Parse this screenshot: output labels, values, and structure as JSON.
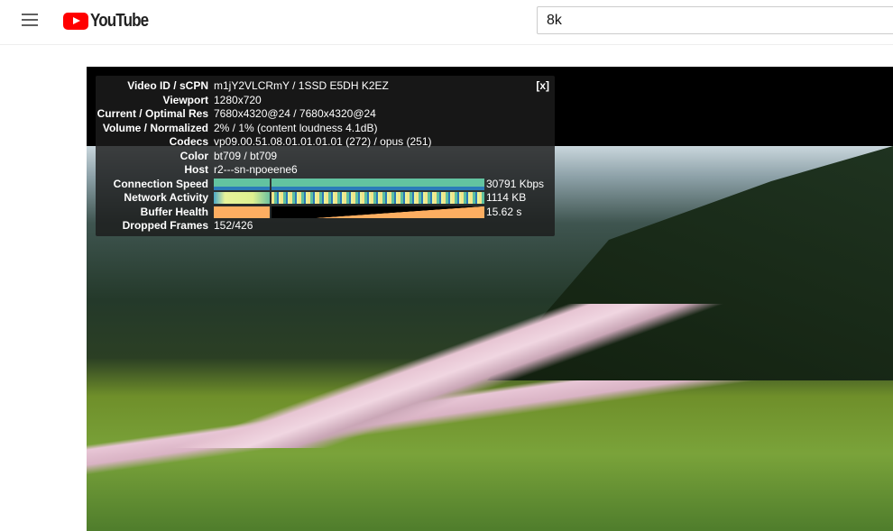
{
  "header": {
    "logo_text": "YouTube",
    "search_value": "8k"
  },
  "stats": {
    "close_label": "[x]",
    "rows": [
      {
        "label": "Video ID / sCPN",
        "value": "m1jY2VLCRmY / 1SSD E5DH K2EZ"
      },
      {
        "label": "Viewport",
        "value": "1280x720"
      },
      {
        "label": "Current / Optimal Res",
        "value": "7680x4320@24 / 7680x4320@24"
      },
      {
        "label": "Volume / Normalized",
        "value": "2% / 1% (content loudness 4.1dB)"
      },
      {
        "label": "Codecs",
        "value": "vp09.00.51.08.01.01.01.01 (272) / opus (251)"
      },
      {
        "label": "Color",
        "value": "bt709 / bt709"
      },
      {
        "label": "Host",
        "value": "r2---sn-npoeene6"
      },
      {
        "label": "Connection Speed",
        "value": "30791 Kbps"
      },
      {
        "label": "Network Activity",
        "value": "1114 KB"
      },
      {
        "label": "Buffer Health",
        "value": "15.62 s"
      },
      {
        "label": "Dropped Frames",
        "value": "152/426"
      }
    ]
  }
}
